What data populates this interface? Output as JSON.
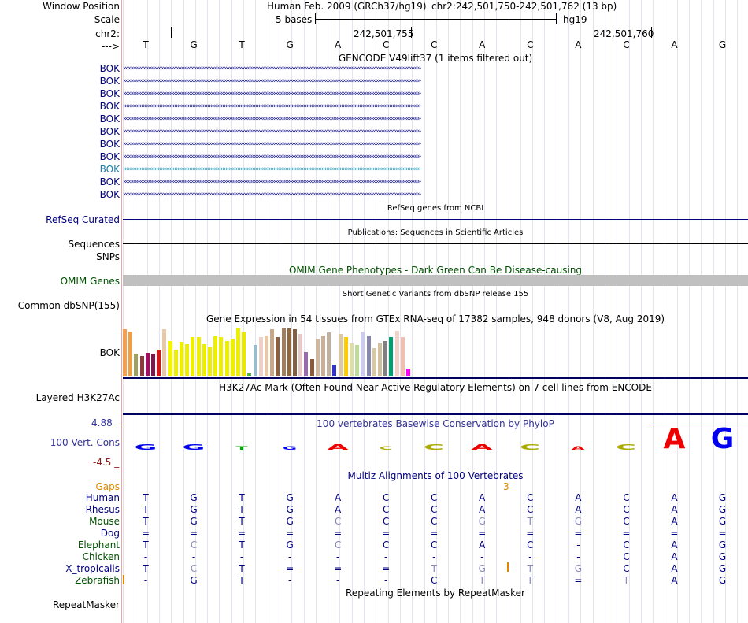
{
  "colors": {
    "navy": "#000080",
    "green": "#005000",
    "orange": "#d08000",
    "purple": "#333399",
    "teal": "#1a7fa8",
    "gray": "#c0c0c0",
    "red": "#8b1a1a"
  },
  "header": {
    "window_position_label": "Window Position",
    "assembly": "Human Feb. 2009 (GRCh37/hg19)",
    "position": "chr2:242,501,750-242,501,762 (13 bp)",
    "scale_label": "Scale",
    "scale_text": "5 bases",
    "scale_db": "hg19",
    "chrom_label": "chr2:",
    "coord1": "242,501,755",
    "coord2": "242,501,760",
    "strand_label": "--->",
    "bases": [
      "T",
      "G",
      "T",
      "G",
      "A",
      "C",
      "C",
      "A",
      "C",
      "A",
      "C",
      "A",
      "G"
    ]
  },
  "tracks": {
    "gencode_title": "GENCODE V49lift37 (1 items filtered out)",
    "gencode_items": [
      "BOK",
      "BOK",
      "BOK",
      "BOK",
      "BOK",
      "BOK",
      "BOK",
      "BOK",
      "BOK",
      "BOK",
      "BOK"
    ],
    "refseq_title": "RefSeq genes from NCBI",
    "refseq_label": "RefSeq Curated",
    "pubs_title": "Publications: Sequences in Scientific Articles",
    "sequences_label": "Sequences",
    "snps_label": "SNPs",
    "omim_title": "OMIM Gene Phenotypes - Dark Green Can Be Disease-causing",
    "omim_label": "OMIM Genes",
    "dbsnp_title": "Short Genetic Variants from dbSNP release 155",
    "dbsnp_label": "Common dbSNP(155)",
    "gtex_title": "Gene Expression in 54 tissues from GTEx RNA-seq of 17382 samples, 948 donors (V8, Aug 2019)",
    "gtex_label": "BOK",
    "gtex_bars": [
      {
        "h": 0.89,
        "c": "#f5a050"
      },
      {
        "h": 0.85,
        "c": "#f0a040"
      },
      {
        "h": 0.43,
        "c": "#a0a060"
      },
      {
        "h": 0.39,
        "c": "#8b3a3a"
      },
      {
        "h": 0.45,
        "c": "#a01060"
      },
      {
        "h": 0.43,
        "c": "#7a1a4a"
      },
      {
        "h": 0.5,
        "c": "#d01818"
      },
      {
        "h": 0.89,
        "c": "#e8c8a8"
      },
      {
        "h": 0.67,
        "c": "#f5f500"
      },
      {
        "h": 0.5,
        "c": "#eeee00"
      },
      {
        "h": 0.65,
        "c": "#eeee00"
      },
      {
        "h": 0.61,
        "c": "#eeee00"
      },
      {
        "h": 0.74,
        "c": "#eeee00"
      },
      {
        "h": 0.74,
        "c": "#eeee00"
      },
      {
        "h": 0.61,
        "c": "#eeee00"
      },
      {
        "h": 0.57,
        "c": "#eeee00"
      },
      {
        "h": 0.76,
        "c": "#eeee00"
      },
      {
        "h": 0.74,
        "c": "#eeee00"
      },
      {
        "h": 0.67,
        "c": "#eeee00"
      },
      {
        "h": 0.71,
        "c": "#eeee00"
      },
      {
        "h": 0.93,
        "c": "#eeee00"
      },
      {
        "h": 0.85,
        "c": "#e8e800"
      },
      {
        "h": 0.07,
        "c": "#55b040"
      },
      {
        "h": 0.59,
        "c": "#99bbcc"
      },
      {
        "h": 0.74,
        "c": "#f0d0c8"
      },
      {
        "h": 0.78,
        "c": "#e8c8a8"
      },
      {
        "h": 0.89,
        "c": "#c8a888"
      },
      {
        "h": 0.74,
        "c": "#8b6040"
      },
      {
        "h": 0.93,
        "c": "#a08060"
      },
      {
        "h": 0.91,
        "c": "#906840"
      },
      {
        "h": 0.89,
        "c": "#806040"
      },
      {
        "h": 0.8,
        "c": "#e8c8c8"
      },
      {
        "h": 0.46,
        "c": "#9a6ab0"
      },
      {
        "h": 0.33,
        "c": "#8b5a3a"
      },
      {
        "h": 0.71,
        "c": "#d0b8a0"
      },
      {
        "h": 0.78,
        "c": "#c8b098"
      },
      {
        "h": 0.83,
        "c": "#c0b0a0"
      },
      {
        "h": 0.22,
        "c": "#3333cc"
      },
      {
        "h": 0.8,
        "c": "#dcc8a8"
      },
      {
        "h": 0.74,
        "c": "#ffcc00"
      },
      {
        "h": 0.63,
        "c": "#ddddaa"
      },
      {
        "h": 0.59,
        "c": "#bbdd99"
      },
      {
        "h": 0.85,
        "c": "#ccccee"
      },
      {
        "h": 0.78,
        "c": "#8888aa"
      },
      {
        "h": 0.54,
        "c": "#d8c8a8"
      },
      {
        "h": 0.63,
        "c": "#d0c0a0"
      },
      {
        "h": 0.67,
        "c": "#808080"
      },
      {
        "h": 0.74,
        "c": "#00a070"
      },
      {
        "h": 0.87,
        "c": "#f0d0c8"
      },
      {
        "h": 0.74,
        "c": "#f0c0b0"
      },
      {
        "h": 0.15,
        "c": "#ff00ff"
      }
    ],
    "h3k27ac_title": "H3K27Ac Mark (Often Found Near Active Regulatory Elements) on 7 cell lines from ENCODE",
    "h3k27ac_label": "Layered H3K27Ac",
    "phylop_title": "100 vertebrates Basewise Conservation by PhyloP",
    "phylop_label": "100 Vert. Cons",
    "phylop_max": "4.88 _",
    "phylop_min": "-4.5 _",
    "multiz_title": "Multiz Alignments of 100 Vertebrates",
    "gaps_label": "Gaps",
    "gaps_count": "3",
    "repeat_title": "Repeating Elements by RepeatMasker",
    "repeat_label": "RepeatMasker"
  },
  "alignment": [
    {
      "species": "Human",
      "color": "#000080",
      "bases": [
        "T",
        "G",
        "T",
        "G",
        "A",
        "C",
        "C",
        "A",
        "C",
        "A",
        "C",
        "A",
        "G"
      ],
      "dim": [
        0,
        0,
        0,
        0,
        0,
        0,
        0,
        0,
        0,
        0,
        0,
        0,
        0
      ]
    },
    {
      "species": "Rhesus",
      "color": "#000080",
      "bases": [
        "T",
        "G",
        "T",
        "G",
        "A",
        "C",
        "C",
        "A",
        "C",
        "A",
        "C",
        "A",
        "G"
      ],
      "dim": [
        0,
        0,
        0,
        0,
        0,
        0,
        0,
        0,
        0,
        0,
        0,
        0,
        0
      ]
    },
    {
      "species": "Mouse",
      "color": "#005000",
      "bases": [
        "T",
        "G",
        "T",
        "G",
        "C",
        "C",
        "C",
        "G",
        "T",
        "G",
        "C",
        "A",
        "G"
      ],
      "dim": [
        0,
        0,
        0,
        0,
        1,
        0,
        0,
        1,
        1,
        1,
        0,
        0,
        0
      ]
    },
    {
      "species": "Dog",
      "color": "#000080",
      "bases": [
        "=",
        "=",
        "=",
        "=",
        "=",
        "=",
        "=",
        "=",
        "=",
        "=",
        "=",
        "=",
        "="
      ],
      "dim": [
        0,
        0,
        0,
        0,
        0,
        0,
        0,
        0,
        0,
        0,
        0,
        0,
        0
      ]
    },
    {
      "species": "Elephant",
      "color": "#005000",
      "bases": [
        "T",
        "C",
        "T",
        "G",
        "C",
        "C",
        "C",
        "A",
        "C",
        "-",
        "C",
        "A",
        "G"
      ],
      "dim": [
        0,
        1,
        0,
        0,
        1,
        0,
        0,
        0,
        0,
        0,
        0,
        0,
        0
      ]
    },
    {
      "species": "Chicken",
      "color": "#005000",
      "bases": [
        "-",
        "-",
        "-",
        "-",
        "-",
        "-",
        "-",
        "-",
        "-",
        "-",
        "C",
        "A",
        "G"
      ],
      "dim": [
        0,
        0,
        0,
        0,
        0,
        0,
        0,
        0,
        0,
        0,
        0,
        0,
        0
      ]
    },
    {
      "species": "X_tropicalis",
      "color": "#000080",
      "bases": [
        "T",
        "C",
        "T",
        "=",
        "=",
        "=",
        "T",
        "G",
        "T",
        "G",
        "C",
        "A",
        "G"
      ],
      "dim": [
        0,
        1,
        0,
        0,
        0,
        0,
        1,
        1,
        1,
        1,
        0,
        0,
        0
      ]
    },
    {
      "species": "Zebrafish",
      "color": "#005000",
      "bases": [
        "-",
        "G",
        "T",
        "-",
        "-",
        "-",
        "C",
        "T",
        "T",
        "=",
        "T",
        "A",
        "G"
      ],
      "dim": [
        0,
        0,
        0,
        0,
        0,
        0,
        0,
        1,
        1,
        0,
        1,
        0,
        0
      ]
    }
  ],
  "logos": [
    {
      "t": "G",
      "c": "#0000ee",
      "s": "small"
    },
    {
      "t": "G",
      "c": "#0000ee",
      "s": "small"
    },
    {
      "t": "T",
      "c": "#00aa00",
      "s": "tiny"
    },
    {
      "t": "G",
      "c": "#0000ee",
      "s": "tiny"
    },
    {
      "t": "A",
      "c": "#ee0000",
      "s": "small"
    },
    {
      "t": "C",
      "c": "#aaaa00",
      "s": "tiny"
    },
    {
      "t": "C",
      "c": "#aaaa00",
      "s": "small"
    },
    {
      "t": "A",
      "c": "#ee0000",
      "s": "small"
    },
    {
      "t": "C",
      "c": "#aaaa00",
      "s": "small"
    },
    {
      "t": "A",
      "c": "#ee0000",
      "s": "tiny"
    },
    {
      "t": "C",
      "c": "#aaaa00",
      "s": "small"
    },
    {
      "t": "A",
      "c": "#ee0000",
      "s": "big"
    },
    {
      "t": "G",
      "c": "#0000ee",
      "s": "big"
    }
  ]
}
